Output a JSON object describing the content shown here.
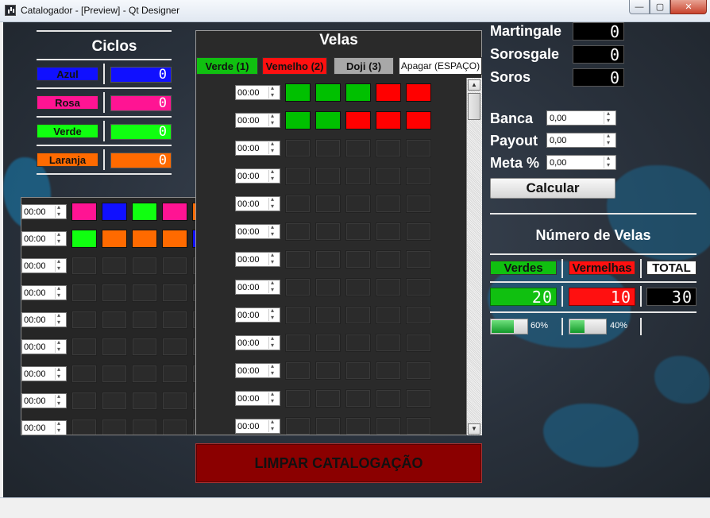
{
  "window": {
    "title": "Catalogador - [Preview] - Qt Designer",
    "min_label": "—",
    "max_label": "▢",
    "close_label": "✕"
  },
  "ciclos": {
    "title": "Ciclos",
    "items": [
      {
        "label": "Azul",
        "color": "#1010ff",
        "value": "0"
      },
      {
        "label": "Rosa",
        "color": "#ff1493",
        "value": "0"
      },
      {
        "label": "Verde",
        "color": "#10ff10",
        "value": "0"
      },
      {
        "label": "Laranja",
        "color": "#ff6a00",
        "value": "0"
      }
    ]
  },
  "ciclos_grid": {
    "rows": [
      {
        "time": "00:00",
        "cells": [
          "#ff1493",
          "#1010ff",
          "#10ff10",
          "#ff1493",
          "#ff6a00"
        ]
      },
      {
        "time": "00:00",
        "cells": [
          "#10ff10",
          "#ff6a00",
          "#ff6a00",
          "#ff6a00",
          "#1010ff"
        ]
      },
      {
        "time": "00:00",
        "cells": [
          "",
          "",
          "",
          "",
          ""
        ]
      },
      {
        "time": "00:00",
        "cells": [
          "",
          "",
          "",
          "",
          ""
        ]
      },
      {
        "time": "00:00",
        "cells": [
          "",
          "",
          "",
          "",
          ""
        ]
      },
      {
        "time": "00:00",
        "cells": [
          "",
          "",
          "",
          "",
          ""
        ]
      },
      {
        "time": "00:00",
        "cells": [
          "",
          "",
          "",
          "",
          ""
        ]
      },
      {
        "time": "00:00",
        "cells": [
          "",
          "",
          "",
          "",
          ""
        ]
      },
      {
        "time": "00:00",
        "cells": [
          "",
          "",
          "",
          "",
          ""
        ]
      }
    ]
  },
  "velas": {
    "title": "Velas",
    "buttons": [
      {
        "label": "Verde (1)",
        "color": "#10c010"
      },
      {
        "label": "Vemelho (2)",
        "color": "#ff1010"
      },
      {
        "label": "Doji (3)",
        "color": "#a8a8a8"
      },
      {
        "label": "Apagar (ESPAÇO)",
        "color": "#ffffff"
      }
    ],
    "rows": [
      {
        "time": "00:00",
        "cells": [
          "#00c000",
          "#00c000",
          "#00c000",
          "#ff0000",
          "#ff0000"
        ]
      },
      {
        "time": "00:00",
        "cells": [
          "#00c000",
          "#00c000",
          "#ff0000",
          "#ff0000",
          "#ff0000"
        ]
      },
      {
        "time": "00:00",
        "cells": [
          "",
          "",
          "",
          "",
          ""
        ]
      },
      {
        "time": "00:00",
        "cells": [
          "",
          "",
          "",
          "",
          ""
        ]
      },
      {
        "time": "00:00",
        "cells": [
          "",
          "",
          "",
          "",
          ""
        ]
      },
      {
        "time": "00:00",
        "cells": [
          "",
          "",
          "",
          "",
          ""
        ]
      },
      {
        "time": "00:00",
        "cells": [
          "",
          "",
          "",
          "",
          ""
        ]
      },
      {
        "time": "00:00",
        "cells": [
          "",
          "",
          "",
          "",
          ""
        ]
      },
      {
        "time": "00:00",
        "cells": [
          "",
          "",
          "",
          "",
          ""
        ]
      },
      {
        "time": "00:00",
        "cells": [
          "",
          "",
          "",
          "",
          ""
        ]
      },
      {
        "time": "00:00",
        "cells": [
          "",
          "",
          "",
          "",
          ""
        ]
      },
      {
        "time": "00:00",
        "cells": [
          "",
          "",
          "",
          "",
          ""
        ]
      },
      {
        "time": "00:00",
        "cells": [
          "",
          "",
          "",
          "",
          ""
        ]
      }
    ],
    "clear_button": "LIMPAR CATALOGAÇÃO"
  },
  "stats": {
    "martingale_label": "Martingale",
    "martingale_value": "0",
    "sorosgale_label": "Sorosgale",
    "sorosgale_value": "0",
    "soros_label": "Soros",
    "soros_value": "0"
  },
  "calc": {
    "banca_label": "Banca",
    "banca_value": "0,00",
    "payout_label": "Payout",
    "payout_value": "0,00",
    "meta_label": "Meta %",
    "meta_value": "0,00",
    "button": "Calcular"
  },
  "numero_velas": {
    "title": "Número de Velas",
    "verdes_label": "Verdes",
    "verdes_value": "20",
    "verdes_color": "#10c010",
    "vermelhas_label": "Vermelhas",
    "vermelhas_value": "10",
    "vermelhas_color": "#ff1010",
    "total_label": "TOTAL",
    "total_value": "30",
    "verdes_pct": 60,
    "verdes_pct_label": "60%",
    "vermelhas_pct": 40,
    "vermelhas_pct_label": "40%"
  }
}
